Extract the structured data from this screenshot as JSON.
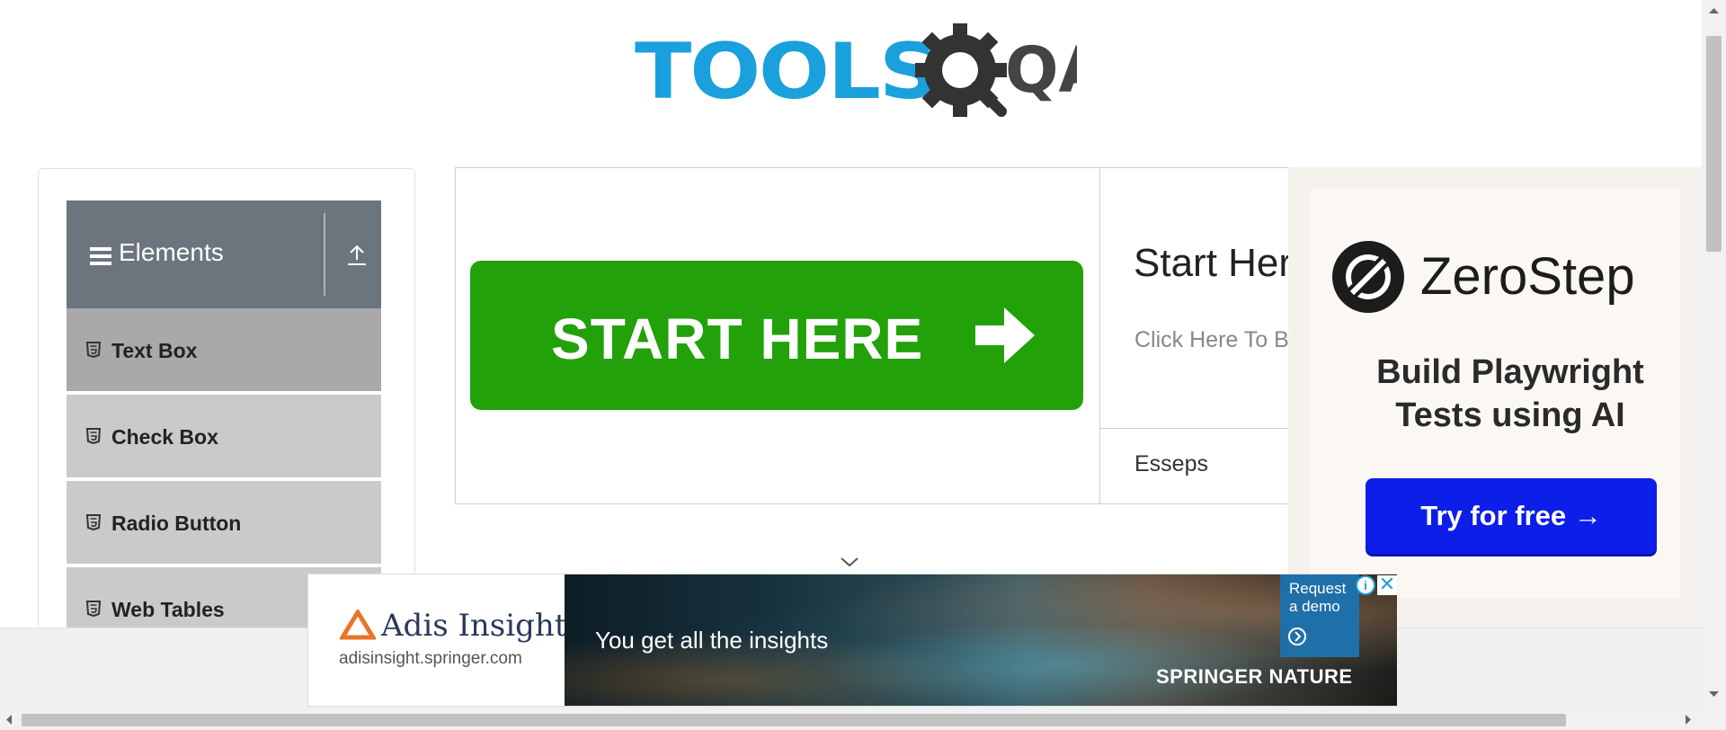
{
  "header": {
    "logo_text": "TOOLS",
    "logo_suffix": "QA"
  },
  "sidebar": {
    "group_title": "Elements",
    "items": [
      {
        "label": "Text Box",
        "active": true
      },
      {
        "label": "Check Box",
        "active": false
      },
      {
        "label": "Radio Button",
        "active": false
      },
      {
        "label": "Web Tables",
        "active": false
      }
    ]
  },
  "banner": {
    "button_label": "START HERE",
    "title": "Start Here",
    "subtitle": "Click Here To Begin",
    "brand": "Esseps"
  },
  "ad_right": {
    "brand": "ZeroStep",
    "tagline_line1": "Build Playwright",
    "tagline_line2": "Tests using AI",
    "cta": "Try for free →",
    "cta_color": "#0c1ee8"
  },
  "ad_bottom": {
    "brand_word": "Adis Insight",
    "url": "adisinsight.springer.com",
    "headline": "You get all the insights",
    "request_label": "Request a demo",
    "publisher": "SPRINGER NATURE"
  },
  "colors": {
    "logo_blue": "#1aa0dc",
    "sidebar_header": "#6c757d",
    "start_green": "#22a10a"
  }
}
